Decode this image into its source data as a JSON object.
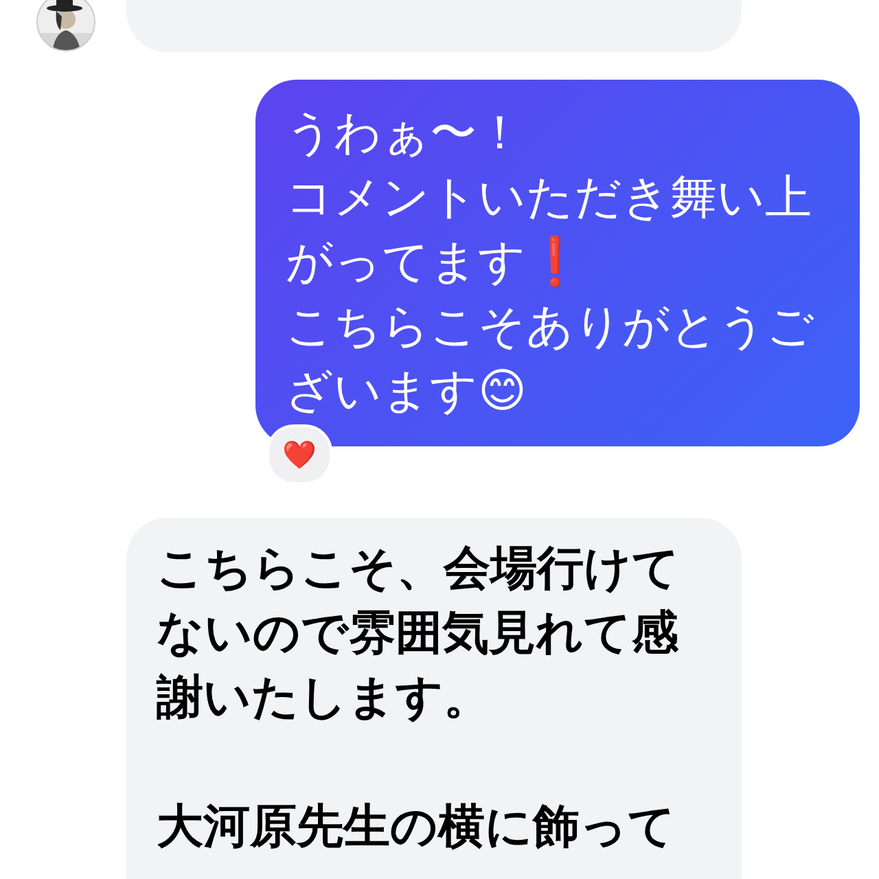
{
  "messages": [
    {
      "kind": "received"
    },
    {
      "kind": "sent",
      "paragraphs": [
        "うわぁ〜！",
        "コメントいただき舞い上がってます❗️",
        "こちらこそありがとうございます😊"
      ],
      "reaction": "❤️"
    },
    {
      "kind": "received",
      "paragraphs": [
        "こちらこそ、会場行けてないので雰囲気見れて感謝いたします。",
        "大河原先生の横に飾って"
      ]
    }
  ]
}
